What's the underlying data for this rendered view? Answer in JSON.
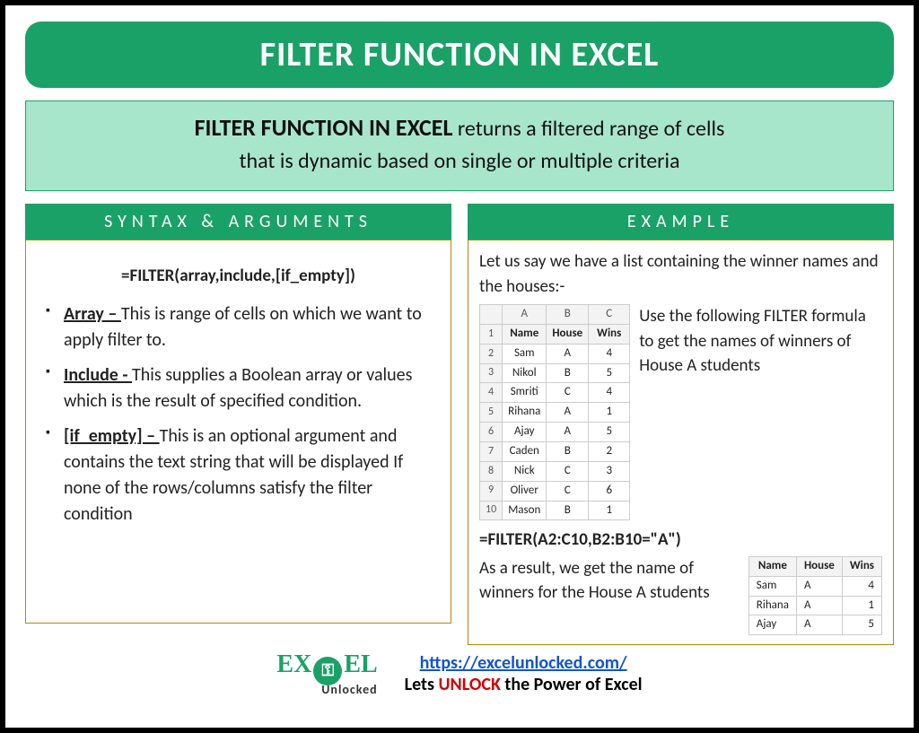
{
  "title": "FILTER FUNCTION IN EXCEL",
  "description": {
    "bold": "FILTER FUNCTION IN EXCEL",
    "rest1": " returns a filtered range of cells",
    "rest2": "that is dynamic based on single or multiple criteria"
  },
  "syntax": {
    "header": "SYNTAX & ARGUMENTS",
    "formula": "=FILTER(array,include,[if_empty])",
    "args": [
      {
        "name": "Array – ",
        "desc": "This is range of cells on which we want to apply filter to."
      },
      {
        "name": "Include -  ",
        "desc": "This supplies a Boolean array or values which is the result of specified condition."
      },
      {
        "name": "[if_empty] – ",
        "desc": "This is an optional argument and contains the text string that will be displayed If none of the rows/columns satisfy the filter condition"
      }
    ]
  },
  "example": {
    "header": "EXAMPLE",
    "intro": "Let us say we have a list containing the winner names and the houses:-",
    "table_cols": [
      "A",
      "B",
      "C"
    ],
    "table_headers": [
      "Name",
      "House",
      "Wins"
    ],
    "table_rows": [
      [
        "Sam",
        "A",
        "4"
      ],
      [
        "Nikol",
        "B",
        "5"
      ],
      [
        "Smriti",
        "C",
        "4"
      ],
      [
        "Rihana",
        "A",
        "1"
      ],
      [
        "Ajay",
        "A",
        "5"
      ],
      [
        "Caden",
        "B",
        "2"
      ],
      [
        "Nick",
        "C",
        "3"
      ],
      [
        "Oliver",
        "C",
        "6"
      ],
      [
        "Mason",
        "B",
        "1"
      ]
    ],
    "side_text": "Use the following FILTER formula to get the names of winners of House A students",
    "formula": "=FILTER(A2:C10,B2:B10=\"A\")",
    "result_text": "As a result, we get the name of winners for the House A students",
    "result_headers": [
      "Name",
      "House",
      "Wins"
    ],
    "result_rows": [
      [
        "Sam",
        "A",
        "4"
      ],
      [
        "Rihana",
        "A",
        "1"
      ],
      [
        "Ajay",
        "A",
        "5"
      ]
    ]
  },
  "footer": {
    "logo_top": "EXCEL",
    "logo_sub": "Unlocked",
    "url": "https://excelunlocked.com/",
    "tag_pre": "Lets ",
    "tag_mid": "UNLOCK",
    "tag_post": " the Power of Excel"
  }
}
